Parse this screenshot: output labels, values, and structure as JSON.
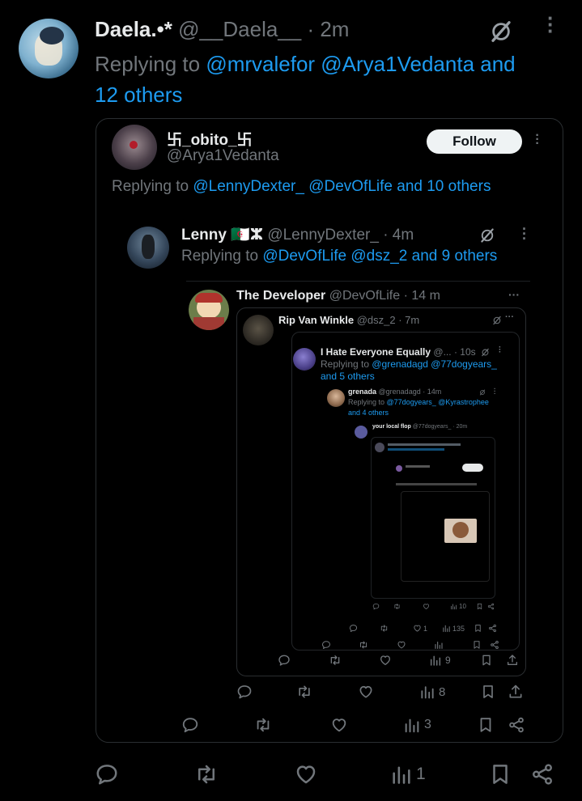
{
  "main_tweet": {
    "name": "Daela.•*",
    "handle": "@__Daela__",
    "time": "· 2m",
    "replying_prefix": "Replying to ",
    "replying_mentions": "@mrvalefor @Arya1Vedanta and",
    "replying_more": "12 others",
    "stats": {
      "replies": "",
      "retweets": "",
      "likes": "",
      "views": "1"
    }
  },
  "quote1": {
    "name": "卐_obito_卐",
    "handle": "@Arya1Vedanta",
    "follow_label": "Follow",
    "replying_prefix": "Replying to ",
    "replying_mentions": "@LennyDexter_ @DevOfLife and 10 others",
    "stats": {
      "views": "3"
    }
  },
  "quote2": {
    "name": "Lenny 🇩🇿ⵣ",
    "handle": "@LennyDexter_",
    "time": "· 4m",
    "replying_prefix": "Replying to ",
    "replying_mentions": "@DevOfLife @dsz_2 and 9 others",
    "stats": {
      "views": "8"
    }
  },
  "quote3": {
    "name": "The Developer",
    "handle": "@DevOfLife",
    "time": "· 14 m",
    "stats": {
      "views": "9"
    }
  },
  "quote4": {
    "name": "Rip Van Winkle",
    "handle": "@dsz_2",
    "time": "· 7m"
  },
  "quote5": {
    "name": "I Hate Everyone Equally",
    "handle": "@...",
    "time": "· 10s",
    "replying_prefix": "Replying to ",
    "replying_mentions": "@grenadagd @77dogyears_",
    "replying_more": "and 5 others",
    "stats": {
      "likes": "1",
      "views": "135"
    }
  },
  "quote6": {
    "name": "grenada",
    "handle": "@grenadagd",
    "time": "· 14m",
    "replying_prefix": "Replying to ",
    "replying_mentions": "@77dogyears_ @Kyrastrophee",
    "replying_more": "and 4 others",
    "stats": {
      "views": "10"
    }
  },
  "quote7": {
    "name": "your local flop",
    "handle": "@77dogyears_",
    "time": "· 20m"
  },
  "colors": {
    "accent": "#1d9bf0",
    "muted": "#71767b",
    "border": "#2f3336",
    "text": "#e7e9ea"
  },
  "icons": [
    "reply-icon",
    "retweet-icon",
    "like-icon",
    "views-icon",
    "bookmark-icon",
    "share-icon",
    "grok-icon",
    "more-icon"
  ]
}
